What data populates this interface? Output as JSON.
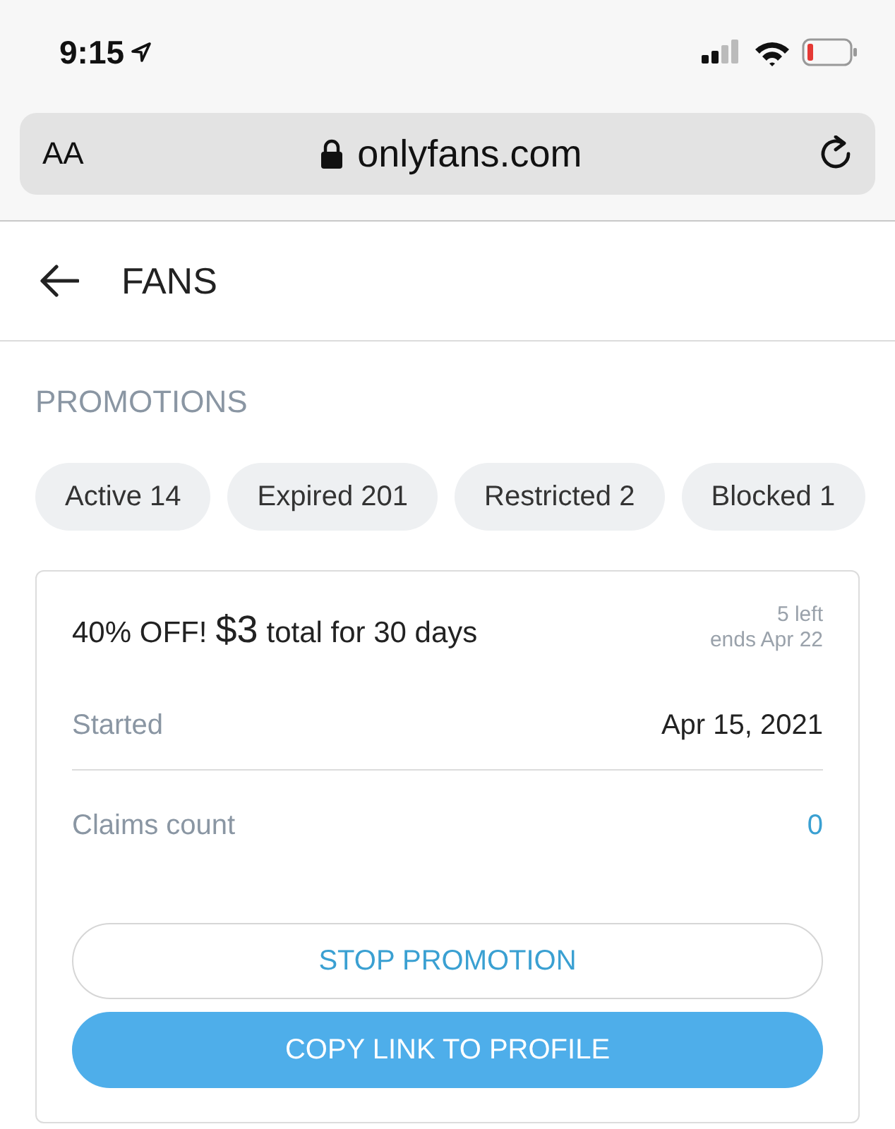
{
  "status_bar": {
    "time": "9:15"
  },
  "browser": {
    "text_size": "AA",
    "url": "onlyfans.com"
  },
  "header": {
    "title": "FANS"
  },
  "section_title": "PROMOTIONS",
  "filters": [
    {
      "label": "Active 14"
    },
    {
      "label": "Expired 201"
    },
    {
      "label": "Restricted 2"
    },
    {
      "label": "Blocked 1"
    }
  ],
  "promotion": {
    "discount": "40% OFF!",
    "price": "$3",
    "terms": "total for 30 days",
    "left": "5 left",
    "ends": "ends Apr 22",
    "rows": [
      {
        "label": "Started",
        "value": "Apr 15, 2021",
        "kind": "plain"
      },
      {
        "label": "Claims count",
        "value": "0",
        "kind": "link"
      }
    ],
    "buttons": [
      {
        "label": "STOP PROMOTION",
        "kind": "outline"
      },
      {
        "label": "COPY LINK TO PROFILE",
        "kind": "primary"
      }
    ]
  }
}
